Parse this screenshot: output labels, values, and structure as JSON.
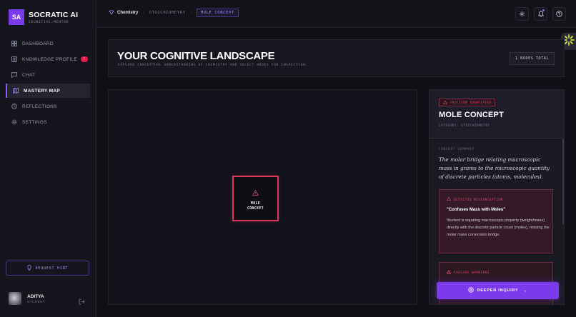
{
  "brand": {
    "logo": "SA",
    "name": "SOCRATIC AI",
    "tagline": "COGNITIVE.MENTOR"
  },
  "nav": [
    {
      "label": "DASHBOARD",
      "icon": "grid-icon"
    },
    {
      "label": "KNOWLEDGE PROFILE",
      "icon": "profile-icon",
      "badge": "!"
    },
    {
      "label": "CHAT",
      "icon": "chat-icon"
    },
    {
      "label": "MASTERY MAP",
      "icon": "map-icon",
      "active": true
    },
    {
      "label": "REFLECTIONS",
      "icon": "reflection-icon"
    },
    {
      "label": "SETTINGS",
      "icon": "gear-icon"
    }
  ],
  "hint_button": "REQUEST HINT",
  "user": {
    "name": "ADITYA",
    "role": "STUDENT"
  },
  "breadcrumb": {
    "root": "Chemistry",
    "middle": "STOICHIOMETRY",
    "current": "MOLE CONCEPT",
    "separator": "›"
  },
  "header": {
    "title": "YOUR COGNITIVE LANDSCAPE",
    "subtitle": "EXPLORE CONCEPTUAL UNDERSTANDING OF CHEMISTRY AND SELECT NODES FOR INSPECTION.",
    "node_count": "1 NODES TOTAL"
  },
  "map": {
    "node_label": "MOLE\nCONCEPT"
  },
  "detail": {
    "status_tag": "FRICTION IDENTIFIED",
    "title": "MOLE CONCEPT",
    "category": "CATEGORY: STOICHIOMETRY",
    "summary_label": "CONCEPT SUMMARY",
    "summary": "The molar bridge relating macroscopic mass in grams to the microscopic quantity of discrete particles (atoms, molecules).",
    "misconception_label": "DETECTED MISCONCEPTION",
    "misconception_title": "\"Confuses Mass with Moles\"",
    "misconception_text": "Student is equating macroscopic property (weight/mass) directly with the discrete particle count (moles), missing the molar mass conversion bridge.",
    "cascade_label": "CASCADE WARNINGS",
    "action_button": "DEEPEN INQUIRY"
  },
  "colors": {
    "accent": "#7c3aed",
    "danger": "#e0486e",
    "background": "#0f0f16"
  }
}
